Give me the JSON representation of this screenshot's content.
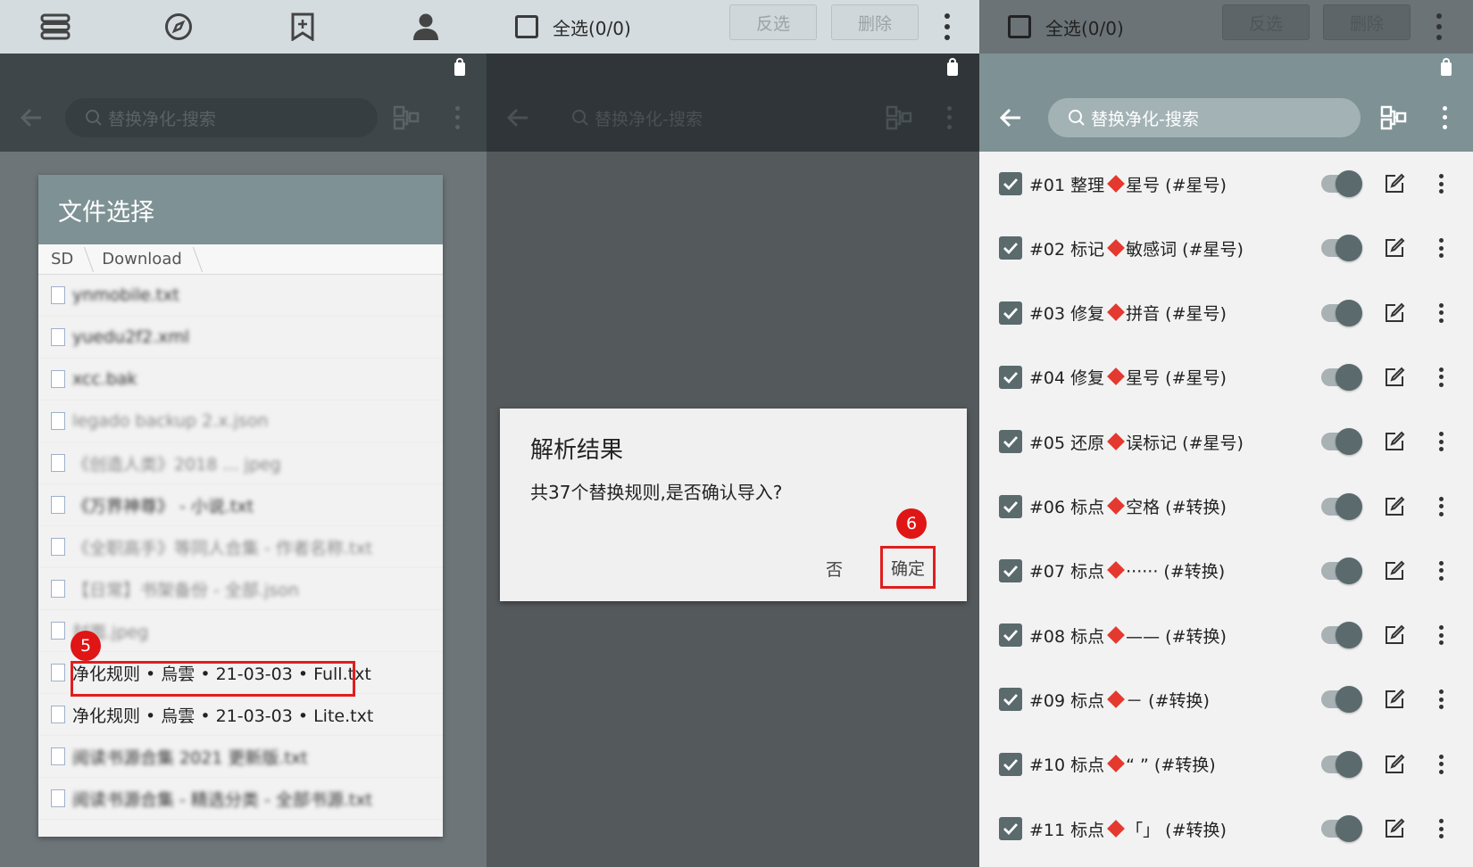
{
  "bottom_nav": {
    "icons": [
      "bookshelf-icon",
      "explore-icon",
      "bookmark-add-icon",
      "person-icon"
    ]
  },
  "selection_bar": {
    "select_all_label": "全选(0/0)",
    "invert_label": "反选",
    "delete_label": "删除"
  },
  "search": {
    "placeholder": "替换净化-搜索"
  },
  "file_dialog": {
    "title": "文件选择",
    "breadcrumb": [
      "SD",
      "Download"
    ],
    "files": [
      {
        "name": "ynmobile.txt",
        "blurred": true,
        "light": false
      },
      {
        "name": "yuedu2f2.xml",
        "blurred": true,
        "light": false
      },
      {
        "name": "xcc.bak",
        "blurred": true,
        "light": false
      },
      {
        "name": "legado backup 2.x.json",
        "blurred": true,
        "light": true
      },
      {
        "name": "《创造人类》2018 ... jpeg",
        "blurred": true,
        "light": true
      },
      {
        "name": "《万界神尊》 - 小说.txt",
        "blurred": true,
        "light": false
      },
      {
        "name": "《全职高手》等同人合集 - 作者名称.txt",
        "blurred": true,
        "light": true
      },
      {
        "name": "【日常】书架备份 - 全部.json",
        "blurred": true,
        "light": true
      },
      {
        "name": "封面.jpeg",
        "blurred": true,
        "light": true
      },
      {
        "name": "净化规则 • 烏雲 • 21-03-03 • Full.txt",
        "blurred": false,
        "light": false
      },
      {
        "name": "净化规则 • 烏雲 • 21-03-03 • Lite.txt",
        "blurred": false,
        "light": false
      },
      {
        "name": "阅读书源合集 2021 更新版.txt",
        "blurred": true,
        "light": false
      },
      {
        "name": "阅读书源合集 - 精选分类 - 全部书源.txt",
        "blurred": true,
        "light": false
      }
    ],
    "annotation": "5"
  },
  "confirm_dialog": {
    "title": "解析结果",
    "message": "共37个替换规则,是否确认导入?",
    "no_label": "否",
    "ok_label": "确定",
    "annotation": "6"
  },
  "rules": [
    {
      "prefix": "#01 整理",
      "suffix": "星号 (#星号)"
    },
    {
      "prefix": "#02 标记",
      "suffix": "敏感词 (#星号)"
    },
    {
      "prefix": "#03 修复",
      "suffix": "拼音 (#星号)"
    },
    {
      "prefix": "#04 修复",
      "suffix": "星号 (#星号)"
    },
    {
      "prefix": "#05 还原",
      "suffix": "误标记 (#星号)"
    },
    {
      "prefix": "#06 标点",
      "suffix": "空格 (#转换)"
    },
    {
      "prefix": "#07 标点",
      "suffix": "······ (#转换)"
    },
    {
      "prefix": "#08 标点",
      "suffix": "—— (#转换)"
    },
    {
      "prefix": "#09 标点",
      "suffix": "－   (#转换)"
    },
    {
      "prefix": "#10 标点",
      "suffix": "“ ” (#转换)"
    },
    {
      "prefix": "#11 标点",
      "suffix": "「」 (#转换)"
    }
  ],
  "colors": {
    "accent": "#7e9194",
    "highlight": "#e01e1e",
    "diamond": "#e4392f",
    "switch_knob": "#5a6a6d"
  }
}
